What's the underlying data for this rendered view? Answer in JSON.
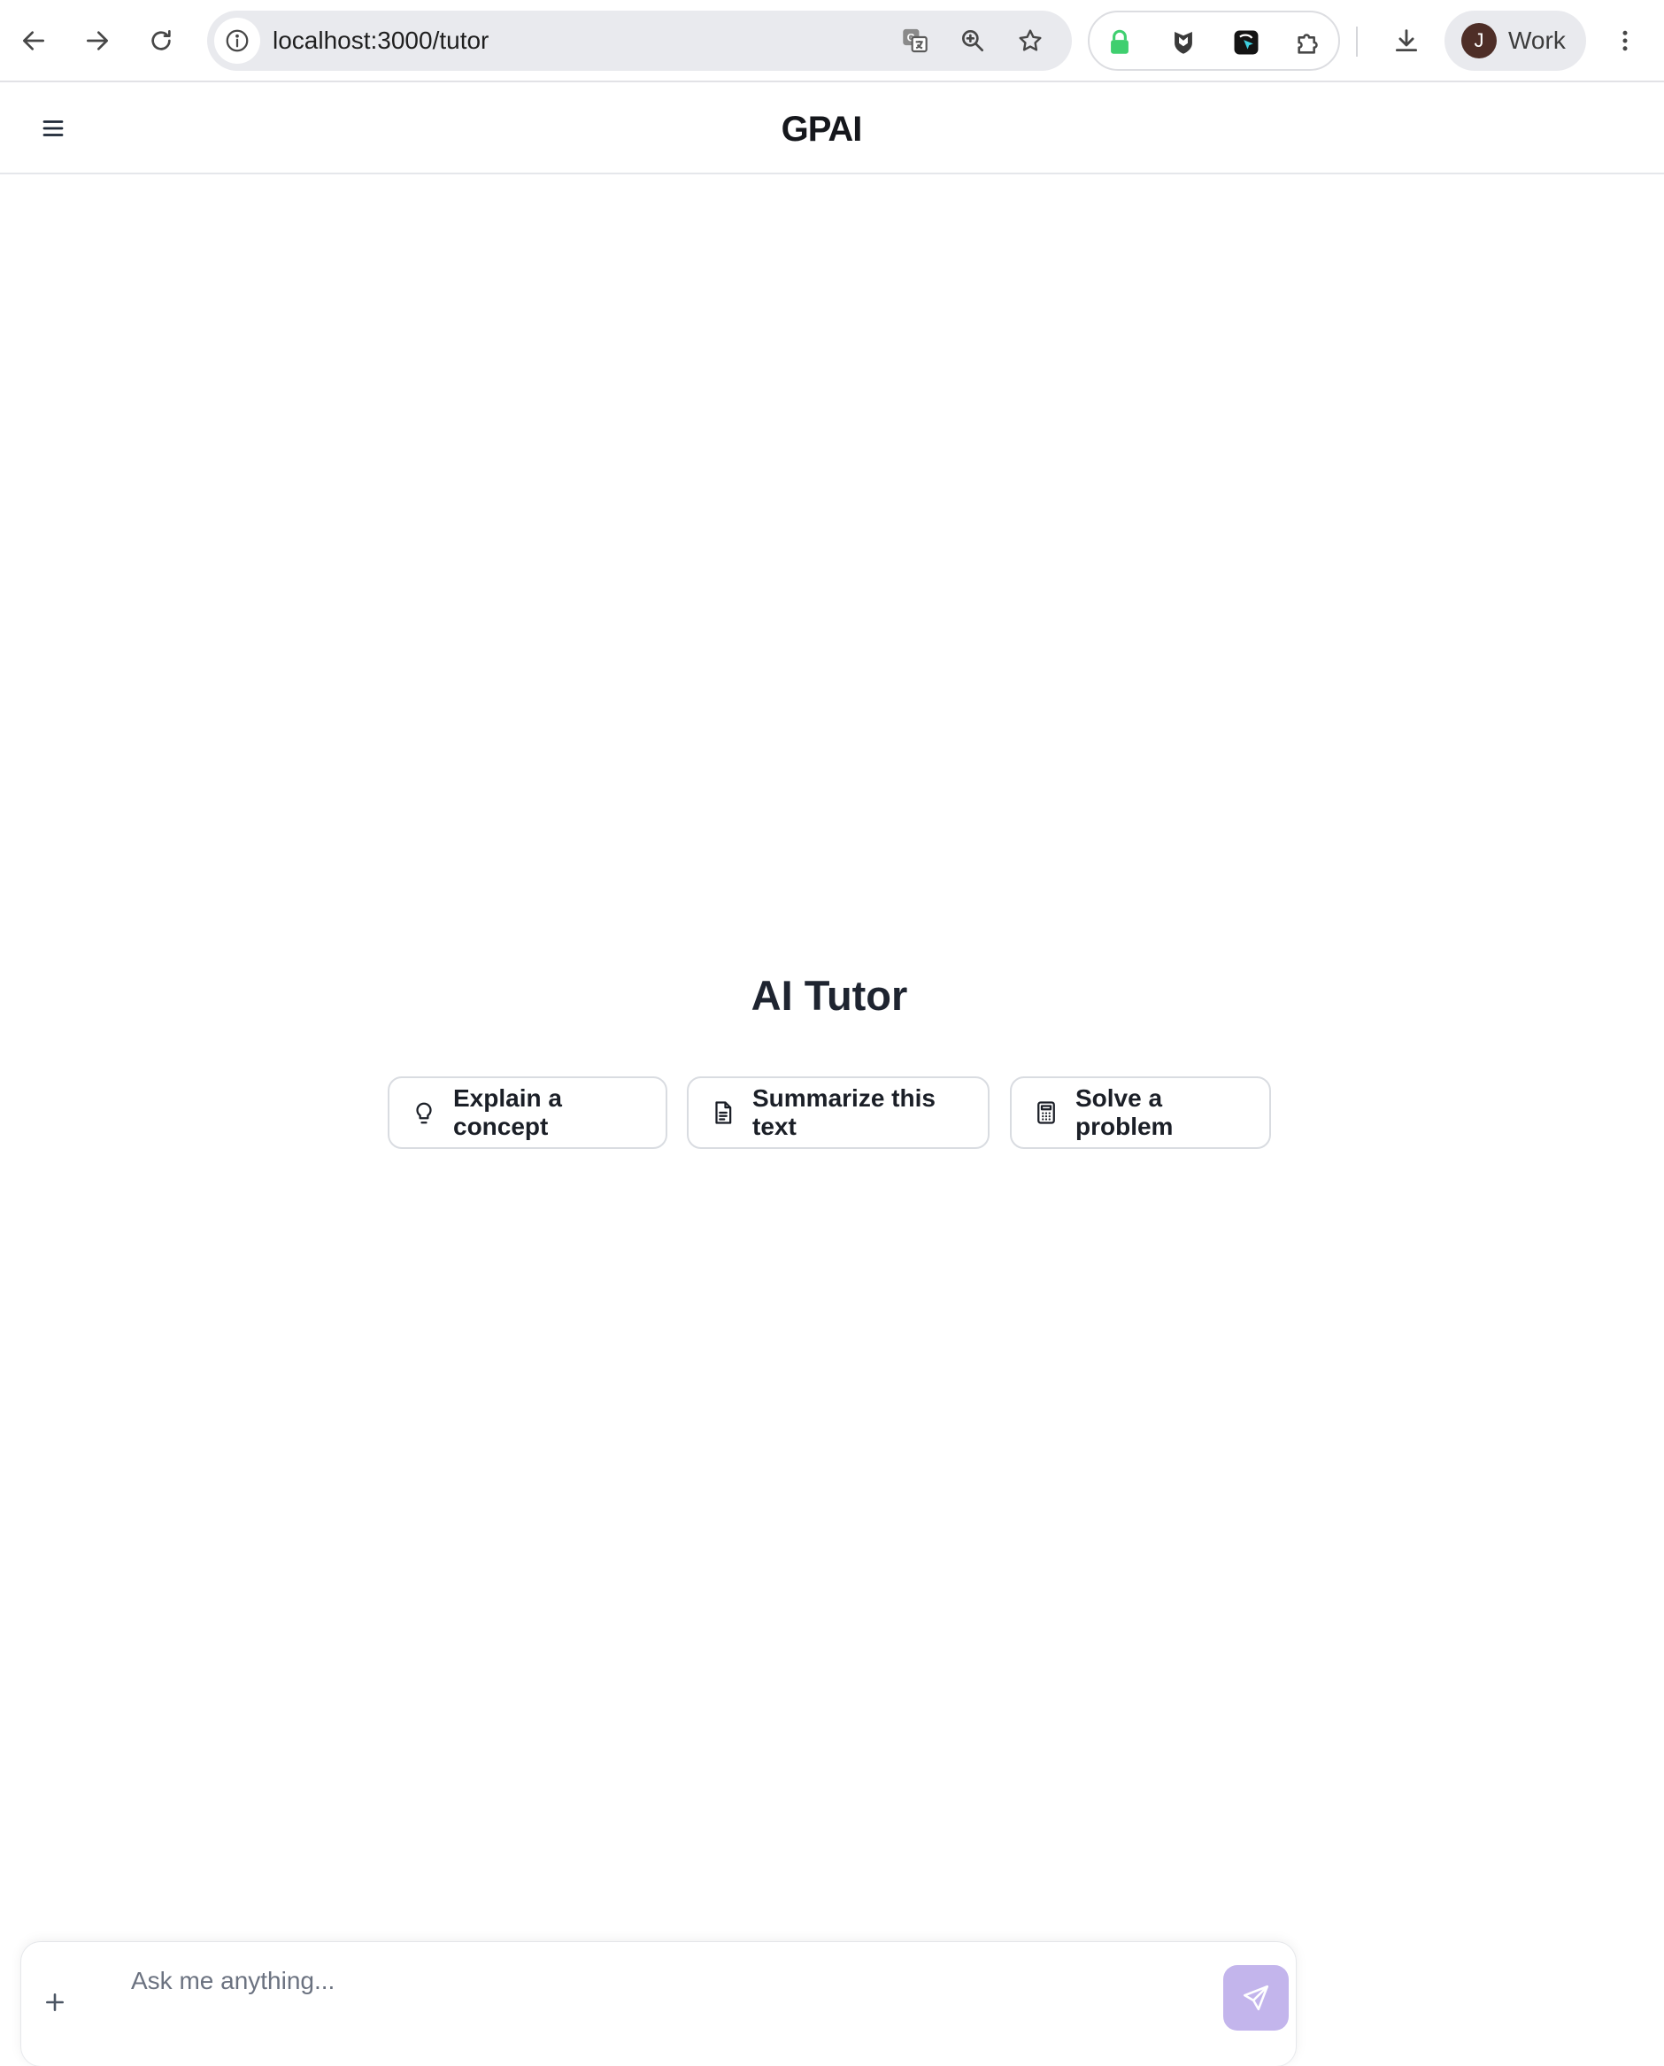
{
  "browser": {
    "url": "localhost:3000/tutor",
    "profile_initial": "J",
    "profile_label": "Work",
    "icons": {
      "back": "arrow-left-icon",
      "forward": "arrow-right-icon",
      "reload": "reload-icon",
      "site_info": "info-icon",
      "translate": "translate-icon",
      "zoom": "zoom-in-icon",
      "bookmark": "star-icon",
      "extensions": [
        "lock-extension-icon",
        "shield-extension-icon",
        "cursor-extension-icon",
        "puzzle-icon"
      ],
      "downloads": "download-icon",
      "menu": "more-vertical-icon"
    }
  },
  "header": {
    "logo_text": "GPAI",
    "menu_icon": "hamburger-icon"
  },
  "main": {
    "title": "AI Tutor",
    "suggestions": [
      {
        "label": "Explain a concept",
        "icon": "lightbulb-icon"
      },
      {
        "label": "Summarize this text",
        "icon": "document-icon"
      },
      {
        "label": "Solve a problem",
        "icon": "calculator-icon"
      }
    ]
  },
  "composer": {
    "placeholder": "Ask me anything...",
    "value": "",
    "attach_icon": "plus-icon",
    "send_icon": "send-icon"
  },
  "colors": {
    "send_button": "#c3b5ec",
    "title_text": "#1e2430",
    "extension_lock_green": "#3fcf6f"
  }
}
